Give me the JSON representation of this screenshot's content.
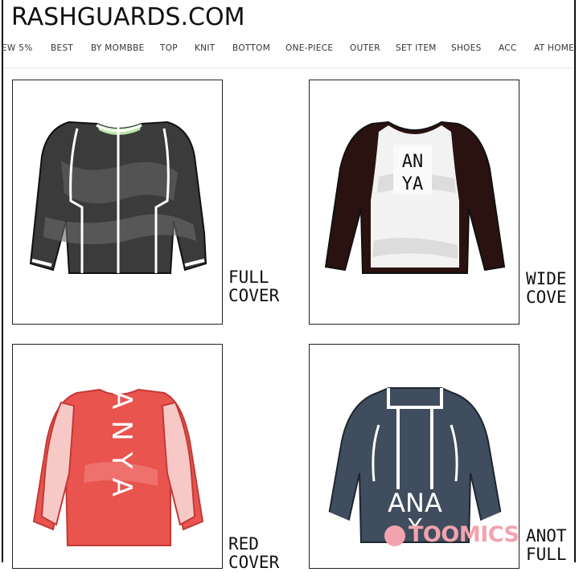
{
  "site": {
    "logo": "RASHGUARDS.COM"
  },
  "nav": {
    "items": [
      "EW 5%",
      "BEST",
      "BY MOMBBE",
      "TOP",
      "KNIT",
      "BOTTOM",
      "ONE-PIECE",
      "OUTER",
      "SET ITEM",
      "SHOES",
      "ACC",
      "AT HOME"
    ]
  },
  "products": [
    {
      "caption_line1": "FULL",
      "caption_line2": "COVER",
      "color": "#3b3b3b",
      "trim": "#ffffff"
    },
    {
      "caption_line1": "WIDE",
      "caption_line2": "COVE",
      "color": "#2a1210",
      "body": "#f2f2f2",
      "print_line1": "AN",
      "print_line2": "YA"
    },
    {
      "caption_line1": "RED",
      "caption_line2": "COVER",
      "color": "#e9544f",
      "print": "ANYA"
    },
    {
      "caption_line1": "ANOT",
      "caption_line2": "FULL",
      "color": "#3f4d5e",
      "print_line1": "ANA",
      "print_line2": "Y"
    }
  ],
  "watermark": {
    "text": "TOOMICS"
  }
}
